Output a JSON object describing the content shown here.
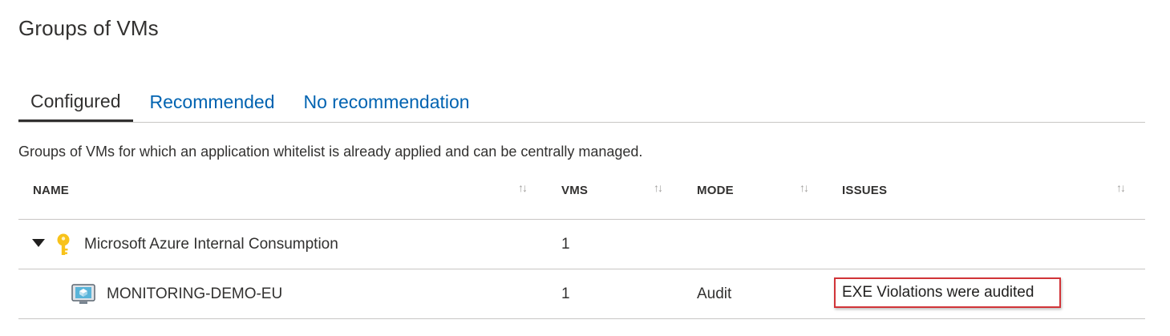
{
  "page": {
    "title": "Groups of VMs",
    "description": "Groups of VMs for which an application whitelist is already applied and can be centrally managed."
  },
  "tabs": [
    {
      "label": "Configured",
      "active": true
    },
    {
      "label": "Recommended",
      "active": false
    },
    {
      "label": "No recommendation",
      "active": false
    }
  ],
  "table": {
    "columns": [
      {
        "label": "NAME",
        "sortable": true
      },
      {
        "label": "VMS",
        "sortable": true
      },
      {
        "label": "MODE",
        "sortable": true
      },
      {
        "label": "ISSUES",
        "sortable": true
      }
    ],
    "sort_glyph": "↑↓",
    "rows": [
      {
        "type": "group",
        "expanded": true,
        "icon": "key-icon",
        "name": "Microsoft Azure Internal Consumption",
        "vms": "1",
        "mode": "",
        "issues": ""
      },
      {
        "type": "vm",
        "icon": "virtual-machine-icon",
        "name": "MONITORING-DEMO-EU",
        "vms": "1",
        "mode": "Audit",
        "issues": "EXE Violations were audited"
      }
    ]
  },
  "colors": {
    "link": "#0063b1",
    "text": "#323130",
    "divider": "#c8c6c4",
    "highlight_border": "#d13438",
    "key_icon": "#f8c21a"
  }
}
